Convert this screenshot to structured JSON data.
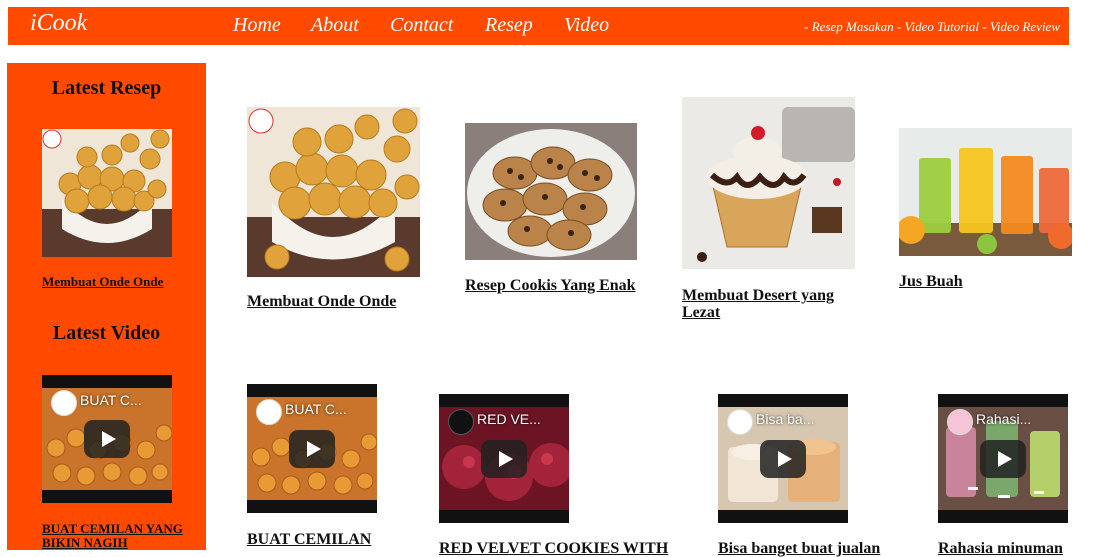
{
  "nav": {
    "brand": "iCook",
    "links": [
      "Home",
      "About",
      "Contact",
      "Resep",
      "Video"
    ],
    "tagline": "- Resep Masakan - Video Tutorial - Video Review"
  },
  "sidebar": {
    "latest_resep_heading": "Latest Resep",
    "latest_resep_item": "Membuat Onde Onde",
    "latest_video_heading": "Latest Video",
    "latest_video_item": "BUAT CEMILAN YANG BIKIN NAGIH",
    "latest_video_overlay": "BUAT C..."
  },
  "resep": [
    {
      "title": "Membuat Onde Onde"
    },
    {
      "title": "Resep Cookis Yang Enak"
    },
    {
      "title": "Membuat Desert yang Lezat"
    },
    {
      "title": "Jus Buah"
    }
  ],
  "videos": [
    {
      "overlay": "BUAT C...",
      "title": "BUAT CEMILAN"
    },
    {
      "overlay": "RED VE...",
      "title": "RED VELVET COOKIES WITH"
    },
    {
      "overlay": "Bisa ba...",
      "title": "Bisa banget buat jualan"
    },
    {
      "overlay": "Rahasi...",
      "title": "Rahasia minuman"
    }
  ],
  "colors": {
    "accent": "#ff4a00",
    "text": "#111111"
  }
}
